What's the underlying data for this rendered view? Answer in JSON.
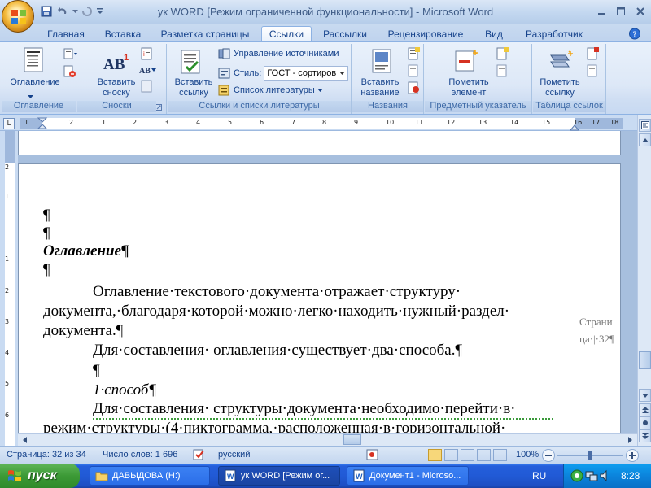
{
  "window": {
    "title": "ук WORD [Режим ограниченной функциональности] - Microsoft Word"
  },
  "tabs": [
    "Главная",
    "Вставка",
    "Разметка страницы",
    "Ссылки",
    "Рассылки",
    "Рецензирование",
    "Вид",
    "Разработчик"
  ],
  "active_tab": "Ссылки",
  "ribbon": {
    "toc": {
      "button": "Оглавление",
      "group": "Оглавление"
    },
    "footnotes": {
      "button_line1": "Вставить",
      "button_line2": "сноску",
      "icon_text": "AB",
      "icon_sup": "1",
      "next_icon_text": "AB",
      "group": "Сноски"
    },
    "citations": {
      "button_line1": "Вставить",
      "button_line2": "ссылку",
      "manage_sources": "Управление источниками",
      "style_label": "Стиль:",
      "style_value": "ГОСТ - сортиров",
      "bibliography": "Список литературы",
      "group": "Ссылки и списки литературы"
    },
    "captions": {
      "button_line1": "Вставить",
      "button_line2": "название",
      "group": "Названия"
    },
    "index": {
      "button_line1": "Пометить",
      "button_line2": "элемент",
      "group": "Предметный указатель"
    },
    "authorities": {
      "button_line1": "Пометить",
      "button_line2": "ссылку",
      "group": "Таблица ссылок"
    }
  },
  "ruler": {
    "tab_selector": "L",
    "marks": [
      "1",
      "2",
      "1",
      "2",
      "3",
      "4",
      "5",
      "6",
      "7",
      "8",
      "9",
      "10",
      "11",
      "12",
      "13",
      "14",
      "15",
      "16",
      "17",
      "18"
    ],
    "vmarks": [
      "2",
      "1",
      "1",
      "2",
      "3",
      "4",
      "5",
      "6"
    ]
  },
  "document": {
    "pilcrow1": "¶",
    "pilcrow2": "¶",
    "heading": "Оглавление¶",
    "empty_para": "¶",
    "p1_line1": "Оглавление·текстового·документа·отражает·структуру·",
    "p1_line2": "документа,·благодаря·которой·можно·легко·находить·нужный·раздел·",
    "p1_line3": "документа.¶",
    "p2": "Для·составления· оглавления·существует·два·способа.¶",
    "pilcrow3": "¶",
    "method": "1·способ¶",
    "p3_line1": "Для·составления· структуры·документа·необходимо·перейти·в·",
    "p3_line2": "режим·структуры·(4·пиктограмма,·расположенная·в·горизонтальной·",
    "margin_line1": "Страни",
    "margin_line2": "ца·|·32¶"
  },
  "statusbar": {
    "page": "Страница: 32 из 34",
    "words": "Число слов: 1 696",
    "language": "русский",
    "zoom": "100%",
    "zoom_level": 100
  },
  "taskbar": {
    "start": "пуск",
    "items": [
      "ДАВЫДОВА (H:)",
      "ук WORD [Режим ог...",
      "Документ1 - Microso..."
    ],
    "lang": "RU",
    "time": "8:28"
  }
}
